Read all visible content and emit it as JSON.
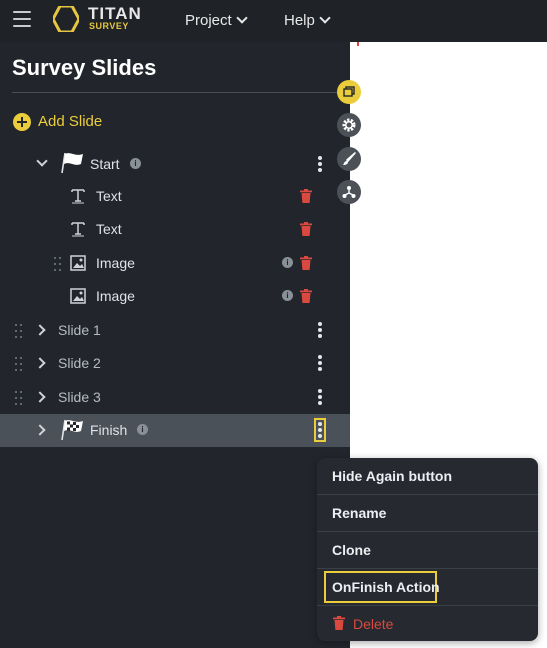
{
  "header": {
    "brand_title": "TITAN",
    "brand_sub": "SURVEY",
    "nav_project": "Project",
    "nav_help": "Help"
  },
  "panel": {
    "title": "Survey Slides",
    "add_slide": "Add Slide",
    "start": {
      "label": "Start",
      "children": [
        "Text",
        "Text",
        "Image",
        "Image"
      ]
    },
    "slides": [
      "Slide 1",
      "Slide 2",
      "Slide 3"
    ],
    "finish": "Finish"
  },
  "context_menu": {
    "items": [
      "Hide Again button",
      "Rename",
      "Clone",
      "OnFinish Action",
      "Delete"
    ]
  },
  "colors": {
    "accent": "#ebcd3b",
    "panel_bg": "#22262c",
    "topbar_bg": "#1f2227",
    "danger": "#d9493f",
    "selected_row": "#4a5159"
  }
}
